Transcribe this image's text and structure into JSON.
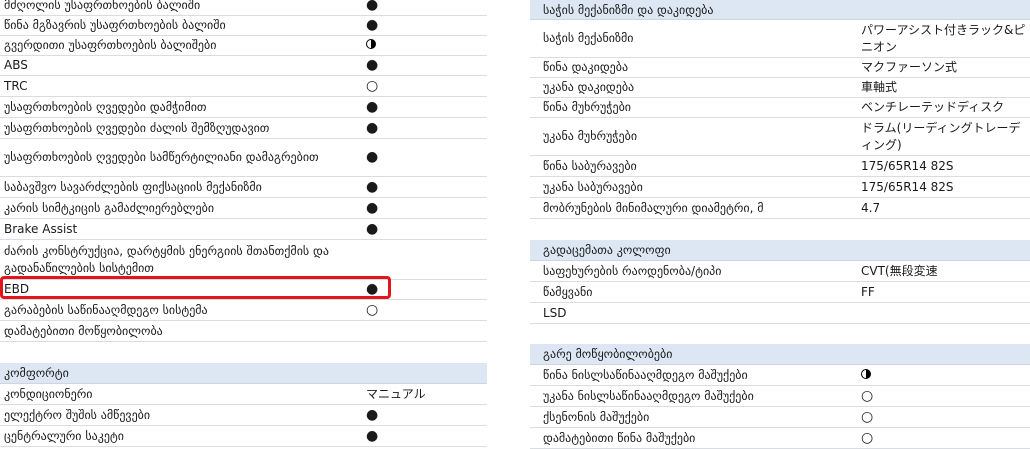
{
  "left": {
    "rows": [
      {
        "label": "მძღოლის უსაფრთხოების ბალიში",
        "mark": "●"
      },
      {
        "label": "წინა მგზავრის უსაფრთხოების ბალიში",
        "mark": "●"
      },
      {
        "label": "გვერდითი უსაფრთხოების ბალიშები",
        "mark": "half"
      },
      {
        "label": "ABS",
        "mark": "●"
      },
      {
        "label": "TRC",
        "mark": "○"
      },
      {
        "label": "უსაფრთხოების ღვედები დამჭიმით",
        "mark": "●"
      },
      {
        "label": "უსაფრთხოების ღვედები ძალის შემზღუდავით",
        "mark": "●"
      },
      {
        "label": "უსაფრთხოების ღვედები სამწერტილიანი დამაგრებით",
        "mark": "●"
      },
      {
        "label": "საბავშვო სავარძლების ფიქსაციის მექანიზმი",
        "mark": "●"
      },
      {
        "label": "კარის სიმტკიცის გამაძლიერებლები",
        "mark": "●"
      },
      {
        "label": "Brake Assist",
        "mark": "●"
      },
      {
        "label": "ძარის კონსტრუქცია, დარტყმის ენერგიის შთანთქმის და გადანაწილების სისტემით",
        "mark": ""
      },
      {
        "label": "EBD",
        "mark": "●"
      },
      {
        "label": "გარაბების საწინააღმდეგო სისტემა",
        "mark": "○"
      },
      {
        "label": "დამატებითი მოწყობილობა",
        "mark": ""
      }
    ],
    "comfort": {
      "title": "კომფორტი",
      "rows": [
        {
          "label": "კონდიციონერი",
          "mark": "マニュアル"
        },
        {
          "label": "ელექტრო შუშის ამწევები",
          "mark": "●"
        },
        {
          "label": "ცენტრალური საკეტი",
          "mark": "●"
        }
      ]
    }
  },
  "right": {
    "sections": [
      {
        "title": "საჭის მექანიზმი და დაკიდება",
        "rows": [
          {
            "label": "საჭის მექანიზმი",
            "value": "パワーアシスト付きラック&ピニオン"
          },
          {
            "label": "წინა დაკიდება",
            "value": "マクファーソン式"
          },
          {
            "label": "უკანა დაკიდება",
            "value": "車軸式"
          },
          {
            "label": "წინა მუხრუჭები",
            "value": "ベンチレーテッドディスク"
          },
          {
            "label": "უკანა მუხრუჭები",
            "value": "ドラム(リーディングトレーディング)"
          },
          {
            "label": "წინა საბურავები",
            "value": "175/65R14 82S"
          },
          {
            "label": "უკანა საბურავები",
            "value": "175/65R14 82S"
          },
          {
            "label": "მობრუნების მინიმალური დიამეტრი, მ",
            "value": "4.7"
          }
        ]
      },
      {
        "title": "გადაცემათა კოლოფი",
        "rows": [
          {
            "label": "საფეხურების რაოდენობა/ტიპი",
            "value": "CVT(無段変速"
          },
          {
            "label": "წამყვანი",
            "value": "FF"
          },
          {
            "label": "LSD",
            "value": ""
          }
        ]
      },
      {
        "title": "გარე მოწყობილობები",
        "rows": [
          {
            "label": "წინა ნისლსაწინააღმდეგო მაშუქები",
            "value": "half"
          },
          {
            "label": "უკანა ნისლსაწინააღმდეგო მაშუქები",
            "value": "○"
          },
          {
            "label": "ქსენონის მაშუქები",
            "value": "○"
          },
          {
            "label": "დამატებითი წინა მაშუქები",
            "value": "○"
          }
        ]
      }
    ]
  }
}
